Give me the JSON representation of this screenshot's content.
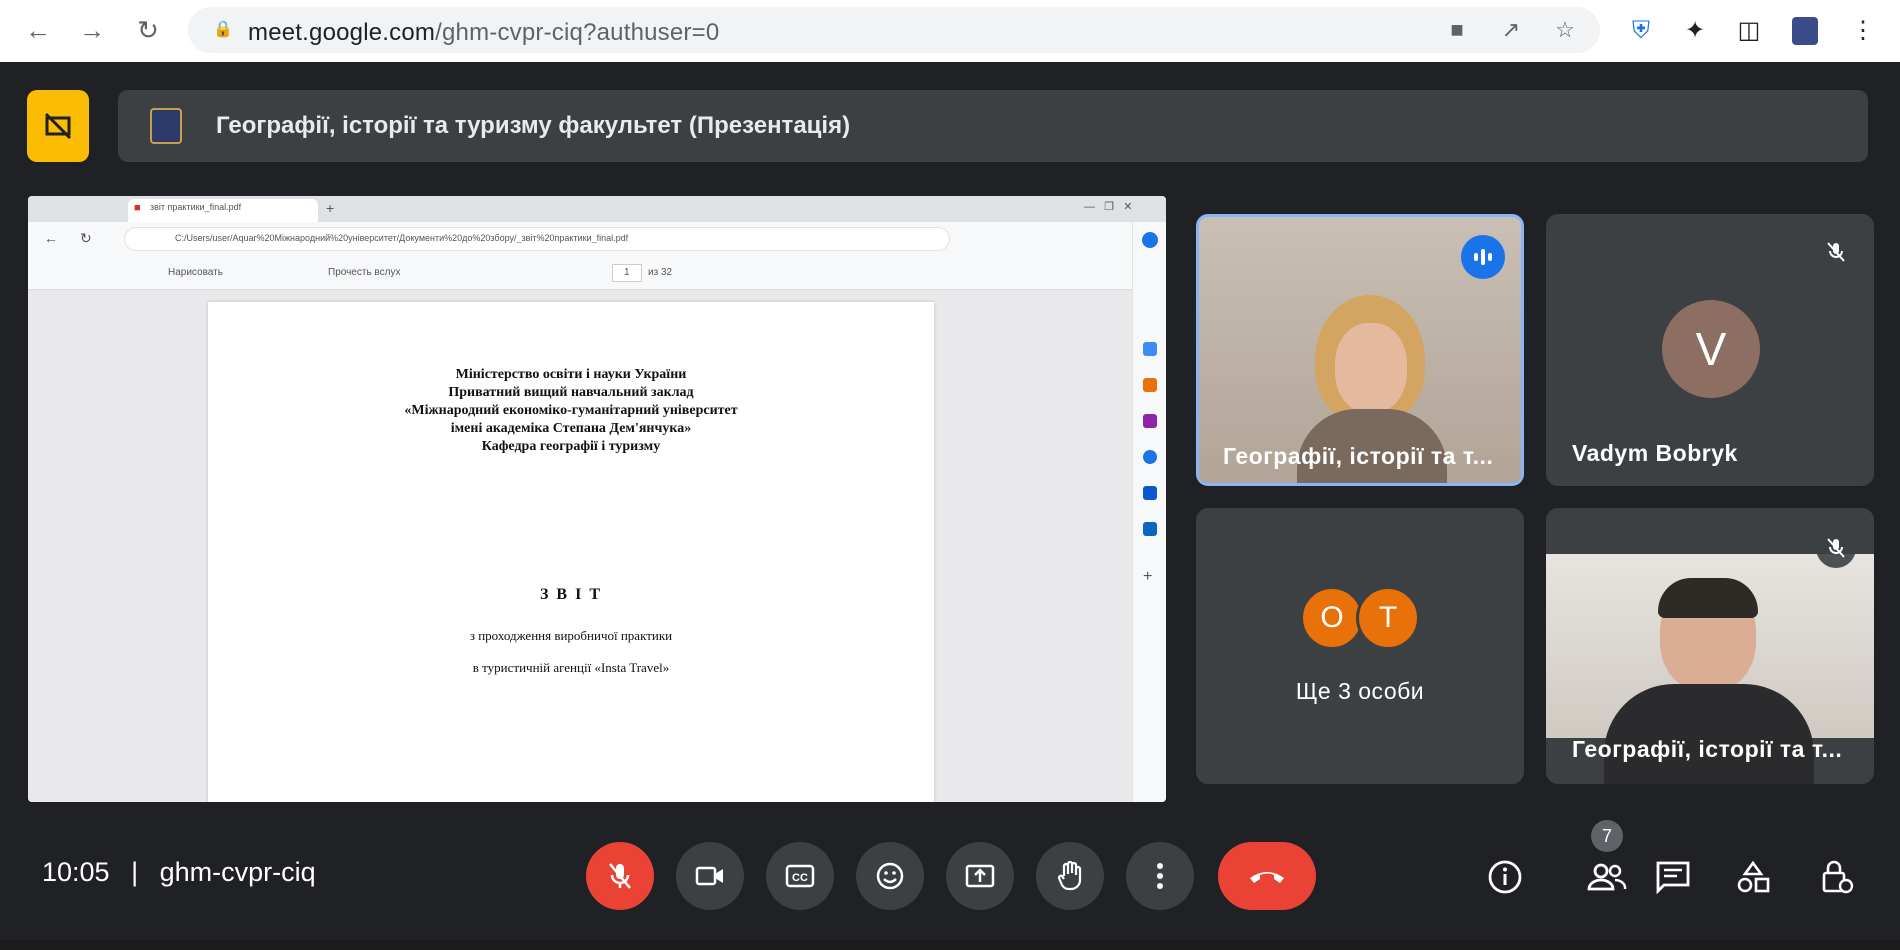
{
  "browser": {
    "url_host": "meet.google.com",
    "url_path": "/ghm-cvpr-ciq?authuser=0"
  },
  "meeting": {
    "title": "Географії, історії та туризму факультет (Презентація)",
    "time": "10:05",
    "separator": "|",
    "code": "ghm-cvpr-ciq",
    "participant_count": "7"
  },
  "presentation": {
    "tab_title": "звіт практики_final.pdf",
    "address": "C:/Users/user/Aquar%20Міжнародний%20університет/Документи%20до%20збору/_звіт%20практики_final.pdf",
    "toolbar": {
      "draw_label": "Нарисовать",
      "read_aloud_label": "Прочесть вслух",
      "page": "1",
      "of_pages": "из 32"
    },
    "doc_header": [
      "Міністерство освіти і науки України",
      "Приватний вищий навчальний заклад",
      "«Міжнародний економіко-гуманітарний університет",
      "імені академіка Степана Дем'янчука»",
      "Кафедра географії і туризму"
    ],
    "doc_title": "З В І Т",
    "doc_sub1": "з проходження виробничої практики",
    "doc_sub2": "в туристичній агенції «Insta Travel»"
  },
  "participants": {
    "tile1_name": "Географії, історії та т...",
    "tile2_name": "Vadym Bobryk",
    "tile2_initial": "V",
    "tile3_initial_a": "O",
    "tile3_initial_b": "T",
    "tile3_label": "Ще 3 особи",
    "tile4_name": "Географії, історії та т..."
  },
  "colors": {
    "background": "#202124",
    "tile": "#3c4043",
    "hangup": "#ea4335",
    "accent_yellow": "#fbbc04",
    "active_speaker": "#8ab4f8",
    "avatar_orange": "#e8710a",
    "avatar_v": "#8d6e63"
  },
  "icons": [
    "back-icon",
    "forward-icon",
    "reload-icon",
    "lock-icon",
    "camera-blocked-icon",
    "share-icon",
    "star-icon",
    "shield-extension-icon",
    "puzzle-icon",
    "side-panel-icon",
    "profile-icon",
    "kebab-menu-icon",
    "presenting-icon",
    "mic-off-icon",
    "videocam-icon",
    "captions-icon",
    "emoji-icon",
    "present-icon",
    "raise-hand-icon",
    "more-options-icon",
    "hangup-icon",
    "info-icon",
    "people-icon",
    "chat-icon",
    "activities-icon",
    "host-controls-icon",
    "audio-level-icon"
  ]
}
